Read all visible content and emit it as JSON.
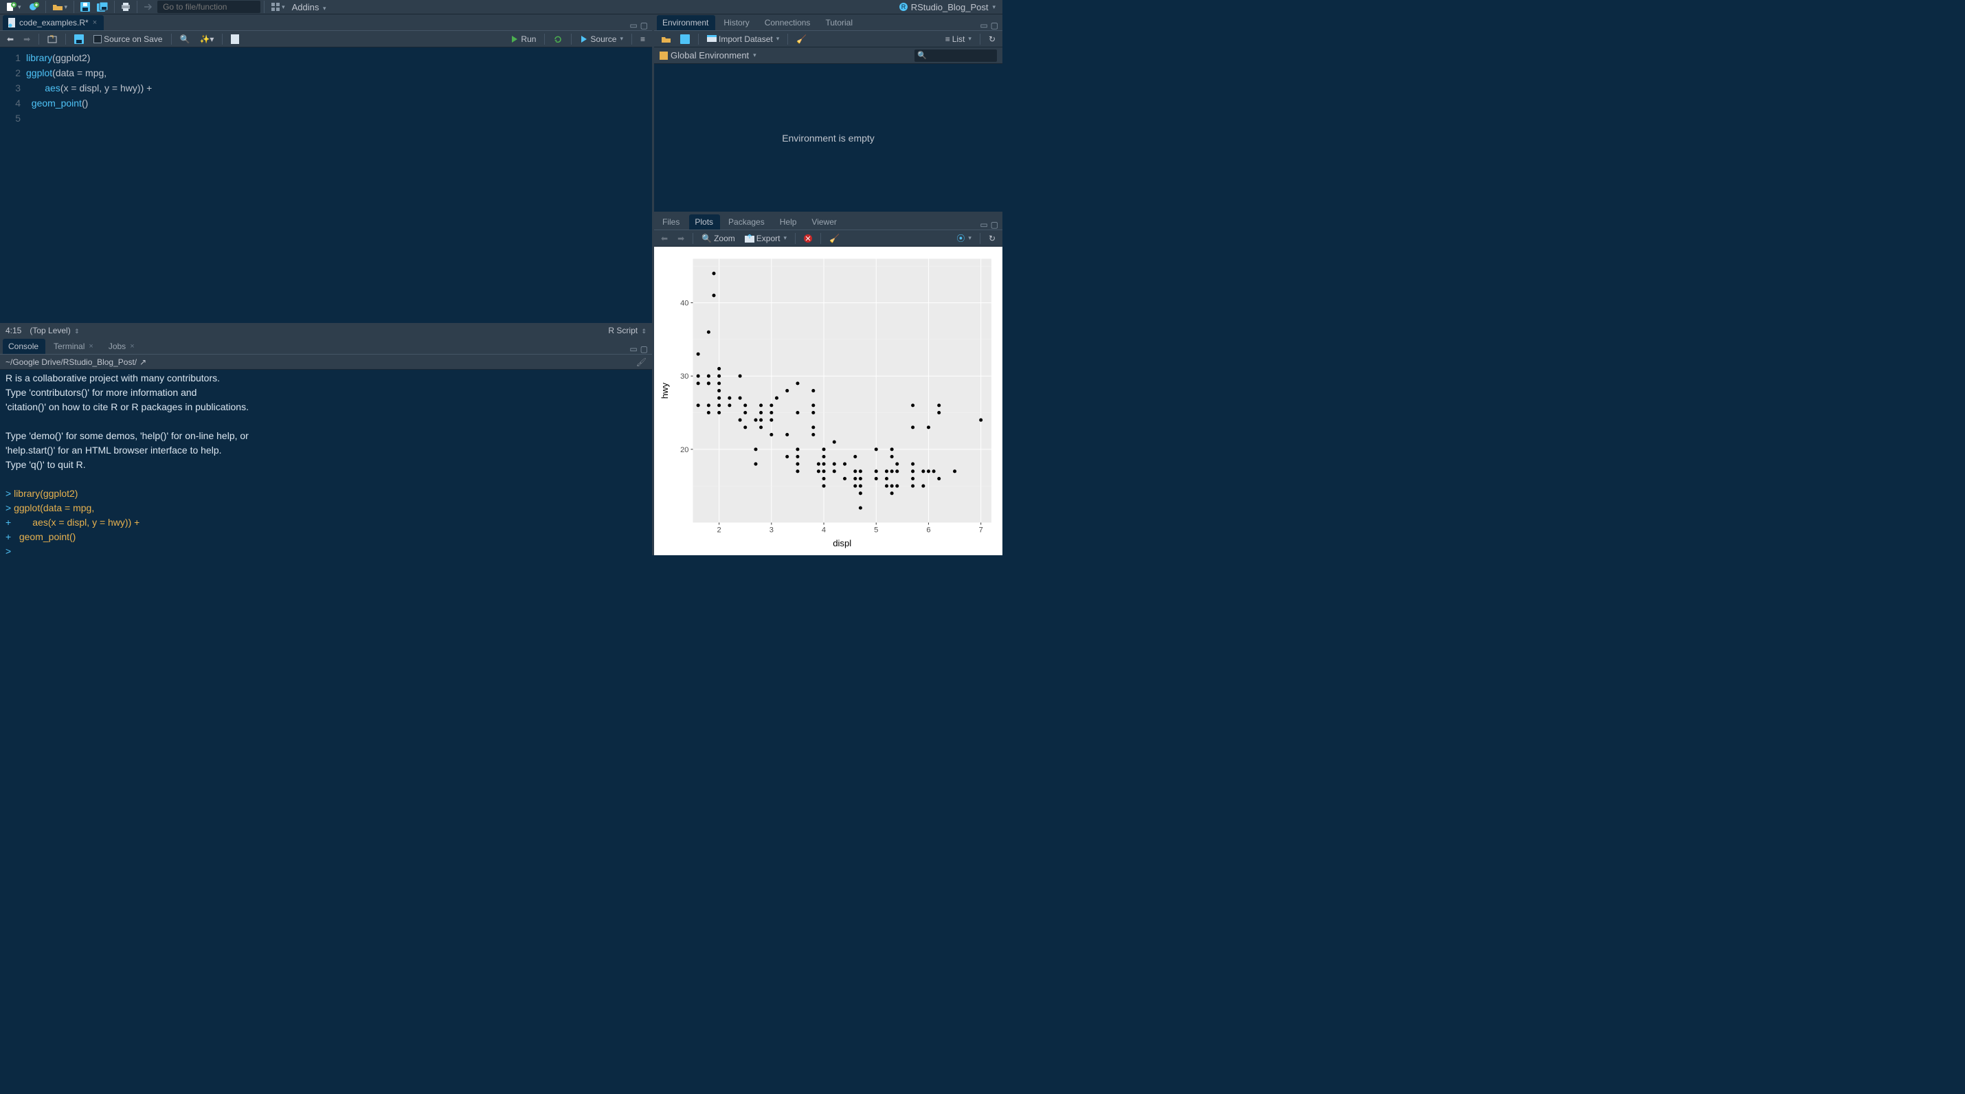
{
  "project_name": "RStudio_Blog_Post",
  "toolbar": {
    "goto_placeholder": "Go to file/function",
    "addins_label": "Addins"
  },
  "editor": {
    "tab_title": "code_examples.R*",
    "source_on_save_label": "Source on Save",
    "run_label": "Run",
    "source_label": "Source",
    "cursor_pos": "4:15",
    "scope": "(Top Level)",
    "filetype": "R Script",
    "lines": [
      {
        "n": "1",
        "tokens": [
          {
            "t": "library",
            "c": "fn"
          },
          {
            "t": "(",
            "c": "paren"
          },
          {
            "t": "ggplot2",
            "c": "var"
          },
          {
            "t": ")",
            "c": "paren"
          }
        ]
      },
      {
        "n": "2",
        "tokens": [
          {
            "t": "ggplot",
            "c": "fn"
          },
          {
            "t": "(",
            "c": "paren"
          },
          {
            "t": "data ",
            "c": "var"
          },
          {
            "t": "=",
            "c": "op"
          },
          {
            "t": " mpg,",
            "c": "var"
          }
        ]
      },
      {
        "n": "3",
        "tokens": [
          {
            "t": "       ",
            "c": "var"
          },
          {
            "t": "aes",
            "c": "fn"
          },
          {
            "t": "(",
            "c": "paren"
          },
          {
            "t": "x ",
            "c": "var"
          },
          {
            "t": "=",
            "c": "op"
          },
          {
            "t": " displ, y ",
            "c": "var"
          },
          {
            "t": "=",
            "c": "op"
          },
          {
            "t": " hwy",
            "c": "var"
          },
          {
            "t": "))",
            "c": "paren"
          },
          {
            "t": " +",
            "c": "op"
          }
        ]
      },
      {
        "n": "4",
        "tokens": [
          {
            "t": "  ",
            "c": "var"
          },
          {
            "t": "geom_point",
            "c": "fn"
          },
          {
            "t": "()",
            "c": "paren"
          }
        ]
      },
      {
        "n": "5",
        "tokens": []
      }
    ]
  },
  "console": {
    "tabs": [
      "Console",
      "Terminal",
      "Jobs"
    ],
    "active_tab": "Console",
    "path": "~/Google Drive/RStudio_Blog_Post/",
    "lines": [
      {
        "p": "",
        "t": "R is a collaborative project with many contributors."
      },
      {
        "p": "",
        "t": "Type 'contributors()' for more information and"
      },
      {
        "p": "",
        "t": "'citation()' on how to cite R or R packages in publications."
      },
      {
        "p": "",
        "t": ""
      },
      {
        "p": "",
        "t": "Type 'demo()' for some demos, 'help()' for on-line help, or"
      },
      {
        "p": "",
        "t": "'help.start()' for an HTML browser interface to help."
      },
      {
        "p": "",
        "t": "Type 'q()' to quit R."
      },
      {
        "p": "",
        "t": ""
      },
      {
        "p": "> ",
        "t": "library(ggplot2)"
      },
      {
        "p": "> ",
        "t": "ggplot(data = mpg,"
      },
      {
        "p": "+ ",
        "t": "       aes(x = displ, y = hwy)) +"
      },
      {
        "p": "+ ",
        "t": "  geom_point()"
      },
      {
        "p": "> ",
        "t": ""
      }
    ]
  },
  "env": {
    "tabs": [
      "Environment",
      "History",
      "Connections",
      "Tutorial"
    ],
    "active_tab": "Environment",
    "import_label": "Import Dataset",
    "view_label": "List",
    "scope_label": "Global Environment",
    "empty_text": "Environment is empty"
  },
  "plots": {
    "tabs": [
      "Files",
      "Plots",
      "Packages",
      "Help",
      "Viewer"
    ],
    "active_tab": "Plots",
    "zoom_label": "Zoom",
    "export_label": "Export"
  },
  "chart_data": {
    "type": "scatter",
    "xlabel": "displ",
    "ylabel": "hwy",
    "xlim": [
      1.5,
      7.2
    ],
    "ylim": [
      10,
      46
    ],
    "xticks": [
      2,
      3,
      4,
      5,
      6,
      7
    ],
    "yticks": [
      20,
      30,
      40
    ],
    "points": [
      [
        1.6,
        33
      ],
      [
        1.6,
        30
      ],
      [
        1.6,
        29
      ],
      [
        1.6,
        26
      ],
      [
        1.8,
        36
      ],
      [
        1.8,
        29
      ],
      [
        1.8,
        29
      ],
      [
        1.8,
        30
      ],
      [
        1.8,
        26
      ],
      [
        1.8,
        25
      ],
      [
        1.9,
        44
      ],
      [
        1.9,
        41
      ],
      [
        2.0,
        31
      ],
      [
        2.0,
        30
      ],
      [
        2.0,
        29
      ],
      [
        2.0,
        28
      ],
      [
        2.0,
        27
      ],
      [
        2.0,
        26
      ],
      [
        2.0,
        25
      ],
      [
        2.2,
        27
      ],
      [
        2.2,
        26
      ],
      [
        2.4,
        30
      ],
      [
        2.4,
        27
      ],
      [
        2.4,
        24
      ],
      [
        2.5,
        26
      ],
      [
        2.5,
        25
      ],
      [
        2.5,
        23
      ],
      [
        2.7,
        24
      ],
      [
        2.7,
        20
      ],
      [
        2.7,
        18
      ],
      [
        2.8,
        26
      ],
      [
        2.8,
        25
      ],
      [
        2.8,
        24
      ],
      [
        2.8,
        23
      ],
      [
        3.0,
        26
      ],
      [
        3.0,
        25
      ],
      [
        3.0,
        24
      ],
      [
        3.0,
        22
      ],
      [
        3.1,
        27
      ],
      [
        3.3,
        28
      ],
      [
        3.3,
        22
      ],
      [
        3.3,
        19
      ],
      [
        3.5,
        29
      ],
      [
        3.5,
        25
      ],
      [
        3.5,
        20
      ],
      [
        3.5,
        19
      ],
      [
        3.5,
        18
      ],
      [
        3.5,
        17
      ],
      [
        3.8,
        26
      ],
      [
        3.8,
        28
      ],
      [
        3.8,
        25
      ],
      [
        3.8,
        23
      ],
      [
        3.8,
        22
      ],
      [
        3.9,
        17
      ],
      [
        3.9,
        18
      ],
      [
        4.0,
        20
      ],
      [
        4.0,
        19
      ],
      [
        4.0,
        18
      ],
      [
        4.0,
        17
      ],
      [
        4.0,
        16
      ],
      [
        4.0,
        15
      ],
      [
        4.2,
        21
      ],
      [
        4.2,
        18
      ],
      [
        4.2,
        17
      ],
      [
        4.4,
        18
      ],
      [
        4.4,
        16
      ],
      [
        4.6,
        19
      ],
      [
        4.6,
        17
      ],
      [
        4.6,
        16
      ],
      [
        4.6,
        15
      ],
      [
        4.7,
        17
      ],
      [
        4.7,
        16
      ],
      [
        4.7,
        15
      ],
      [
        4.7,
        14
      ],
      [
        4.7,
        12
      ],
      [
        5.0,
        20
      ],
      [
        5.0,
        17
      ],
      [
        5.0,
        16
      ],
      [
        5.2,
        17
      ],
      [
        5.2,
        16
      ],
      [
        5.2,
        15
      ],
      [
        5.3,
        20
      ],
      [
        5.3,
        19
      ],
      [
        5.3,
        17
      ],
      [
        5.3,
        15
      ],
      [
        5.3,
        14
      ],
      [
        5.4,
        18
      ],
      [
        5.4,
        17
      ],
      [
        5.4,
        15
      ],
      [
        5.7,
        26
      ],
      [
        5.7,
        23
      ],
      [
        5.7,
        18
      ],
      [
        5.7,
        17
      ],
      [
        5.7,
        16
      ],
      [
        5.7,
        15
      ],
      [
        5.9,
        17
      ],
      [
        5.9,
        15
      ],
      [
        6.0,
        23
      ],
      [
        6.0,
        17
      ],
      [
        6.1,
        17
      ],
      [
        6.2,
        26
      ],
      [
        6.2,
        25
      ],
      [
        6.2,
        16
      ],
      [
        6.5,
        17
      ],
      [
        7.0,
        24
      ]
    ]
  }
}
